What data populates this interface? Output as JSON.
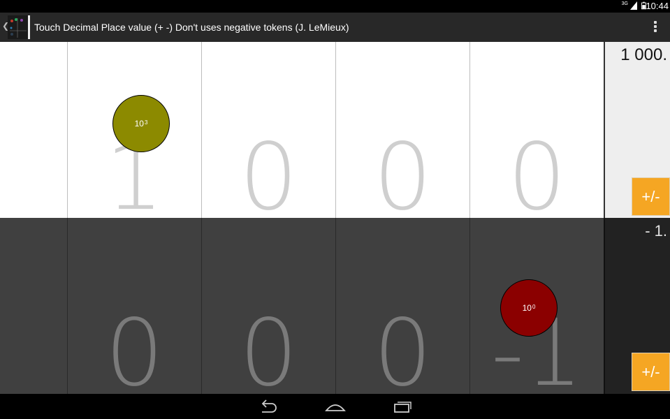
{
  "status_bar": {
    "time": "10:44",
    "network_label": "3G",
    "icons": [
      "signal-icon",
      "battery-icon"
    ]
  },
  "action_bar": {
    "title": "Touch Decimal Place value (+ -) Don't uses negative tokens (J. LeMieux)",
    "icons": [
      "app-icon",
      "overflow-menu-icon"
    ]
  },
  "board": {
    "positive_row": {
      "columns": [
        {
          "digit": ""
        },
        {
          "digit": "1"
        },
        {
          "digit": "0"
        },
        {
          "digit": "0"
        },
        {
          "digit": "0"
        }
      ],
      "total": "1 000.",
      "sign_button_label": "+/-",
      "tokens": [
        {
          "base": "10",
          "exponent": "3",
          "color": "#8c8a00"
        }
      ]
    },
    "negative_row": {
      "columns": [
        {
          "digit": ""
        },
        {
          "digit": "0"
        },
        {
          "digit": "0"
        },
        {
          "digit": "0"
        },
        {
          "digit": "-1"
        }
      ],
      "total": "- 1.",
      "sign_button_label": "+/-",
      "tokens": [
        {
          "base": "10",
          "exponent": "0",
          "color": "#8b0000"
        }
      ]
    }
  },
  "nav_bar": {
    "icons": [
      "back-icon",
      "home-icon",
      "recent-apps-icon"
    ]
  }
}
